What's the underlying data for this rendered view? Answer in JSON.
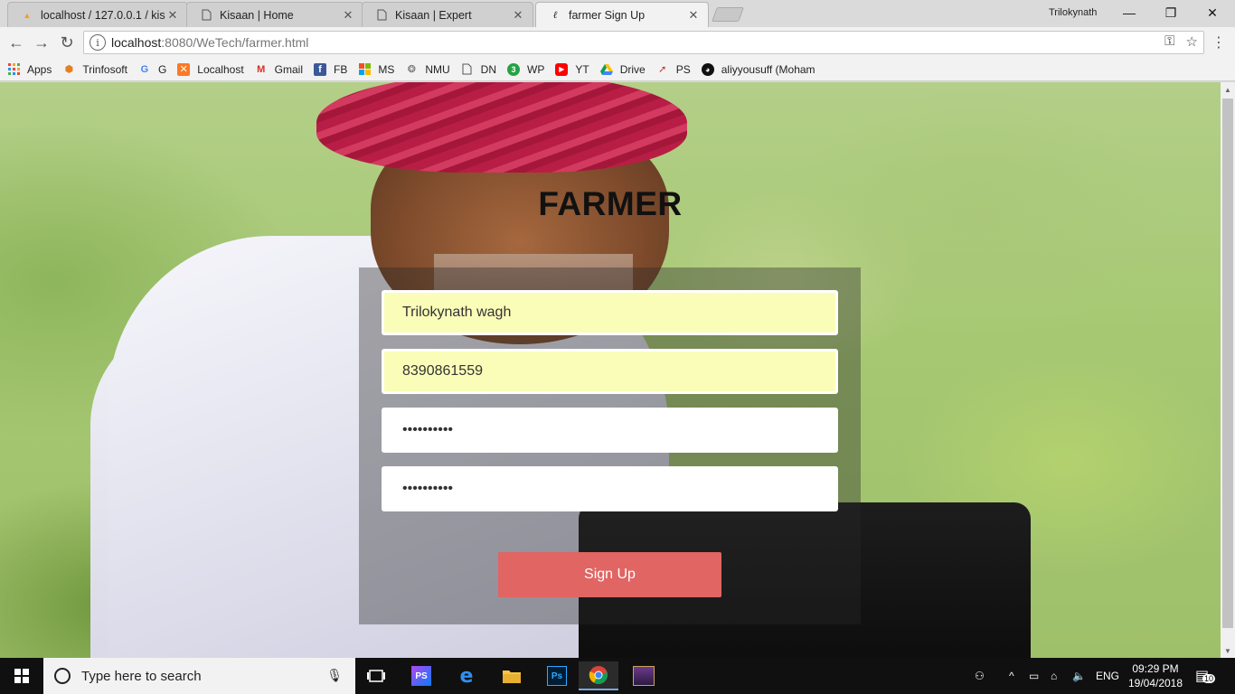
{
  "browser": {
    "tabs": [
      {
        "title": "localhost / 127.0.0.1 / kis",
        "icon": "phpmyadmin-icon",
        "active": false
      },
      {
        "title": "Kisaan | Home",
        "icon": "page-icon",
        "active": false
      },
      {
        "title": "Kisaan | Expert",
        "icon": "page-icon",
        "active": false
      },
      {
        "title": "farmer Sign Up",
        "icon": "page-icon",
        "active": true
      }
    ],
    "profile_name": "Trilokynath",
    "url_host": "localhost",
    "url_path": ":8080/WeTech/farmer.html",
    "bookmarks": [
      {
        "label": "Apps",
        "icon": "apps-grid-icon"
      },
      {
        "label": "Trinfosoft",
        "icon": "trinfosoft-icon"
      },
      {
        "label": "G",
        "icon": "google-icon"
      },
      {
        "label": "Localhost",
        "icon": "xampp-icon"
      },
      {
        "label": "Gmail",
        "icon": "gmail-icon"
      },
      {
        "label": "FB",
        "icon": "facebook-icon"
      },
      {
        "label": "MS",
        "icon": "microsoft-icon"
      },
      {
        "label": "NMU",
        "icon": "nmu-icon"
      },
      {
        "label": "DN",
        "icon": "page-icon"
      },
      {
        "label": "WP",
        "icon": "whatsapp-icon"
      },
      {
        "label": "YT",
        "icon": "youtube-icon"
      },
      {
        "label": "Drive",
        "icon": "drive-icon"
      },
      {
        "label": "PS",
        "icon": "ps-icon"
      },
      {
        "label": "aliyyousuff (Moham",
        "icon": "github-icon"
      }
    ]
  },
  "page": {
    "title": "FARMER",
    "form": {
      "name_value": "Trilokynath wagh",
      "phone_value": "8390861559",
      "password_mask": "••••••••••",
      "confirm_mask": "••••••••••",
      "submit_label": "Sign Up"
    }
  },
  "taskbar": {
    "search_placeholder": "Type here to search",
    "language": "ENG",
    "time": "09:29 PM",
    "date": "19/04/2018",
    "notification_count": "10"
  },
  "colors": {
    "signup_button": "#e06563",
    "autofill_field": "#fafdb8",
    "taskbar": "#101010"
  }
}
